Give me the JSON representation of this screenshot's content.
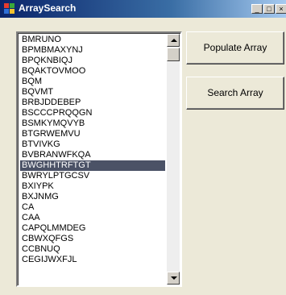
{
  "window": {
    "title": "ArraySearch",
    "controls": {
      "minimize": "_",
      "maximize": "□",
      "close": "×"
    }
  },
  "buttons": {
    "populate": "Populate Array",
    "search": "Search Array"
  },
  "list": {
    "items": [
      "BMRUNO",
      "BPMBMAXYNJ",
      "BPQKNBIQJ",
      "BQAKTOVMOO",
      "BQM",
      "BQVMT",
      "BRBJDDEBEP",
      "BSCCCPRQQGN",
      "BSMKYMQVYB",
      "BTGRWEMVU",
      "BTVIVKG",
      "BVBRANWFKQA",
      "BWGHHTRFTGT",
      "BWRYLPTGCSV",
      "BXIYPK",
      "BXJNMG",
      "CA",
      "CAA",
      "CAPQLMMDEG",
      "CBWXQFGS",
      "CCBNUQ",
      "CEGIJWXFJL"
    ],
    "selected_index": 12
  },
  "colors": {
    "selection": "#4b5266",
    "title_bar_start": "#0a246a",
    "title_bar_end": "#a6caf0"
  },
  "icons": [
    "app-icon",
    "minimize-icon",
    "maximize-icon",
    "close-icon",
    "scroll-up-icon",
    "scroll-down-icon"
  ]
}
